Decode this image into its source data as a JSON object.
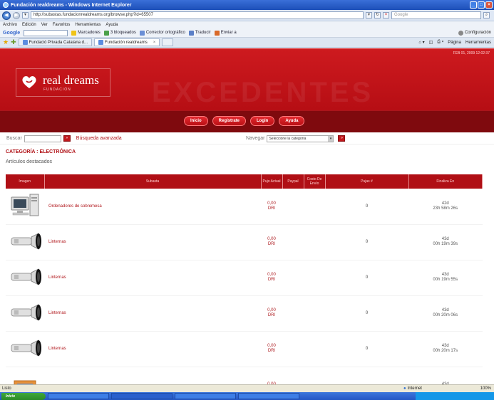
{
  "window": {
    "title": "Fundación realdreams - Windows Internet Explorer"
  },
  "address_bar": {
    "url": "http://subastas.fundacionrealdreams.org/browse.php?id=65507",
    "search_placeholder": "Google"
  },
  "menu": [
    "Archivo",
    "Edición",
    "Ver",
    "Favoritos",
    "Herramientas",
    "Ayuda"
  ],
  "google_toolbar": {
    "logo": "Google",
    "items": [
      "Marcadores",
      "3 bloqueados",
      "Corrector ortográfico",
      "Traducir",
      "Enviar a"
    ],
    "config": "Configuración"
  },
  "tabs": [
    {
      "label": "Fundació Privada Catalana d..."
    },
    {
      "label": "Fundación realdreams"
    }
  ],
  "tab_tools": [
    "Página",
    "Herramientas"
  ],
  "site": {
    "logo_title": "real dreams",
    "logo_subtitle": "FUNDACIÓN",
    "banner_watermark": "EXCEDENTES",
    "date": "FEB 01, 2009 12:02:37",
    "nav": [
      "Inicio",
      "Regístrate",
      "Login",
      "Ayuda"
    ],
    "search_label": "Buscar",
    "search_go": "»",
    "advanced_search": "Búsqueda avanzada",
    "browse_label": "Navegar",
    "browse_select": "Seleccione la categoría",
    "category_title": "CATEGORÍA : ELECTRÓNICA",
    "featured_label": "Artículos destacados"
  },
  "table": {
    "headers": [
      "Imagen",
      "Subasta",
      "Pujo Actual",
      "Paypal",
      "Costo De Envío",
      "Pujas #",
      "Finaliza En"
    ],
    "rows": [
      {
        "image": "desktop-computer",
        "name": "Ordenadores de sobremesa",
        "price": "0,00",
        "currency": "DRI",
        "bids": "0",
        "days": "42d",
        "time": "23h 58m 26s"
      },
      {
        "image": "flashlight",
        "name": "Linternas",
        "price": "0,00",
        "currency": "DRI",
        "bids": "0",
        "days": "43d",
        "time": "00h 19m 39s"
      },
      {
        "image": "flashlight",
        "name": "Linternas",
        "price": "0,00",
        "currency": "DRI",
        "bids": "0",
        "days": "43d",
        "time": "00h 19m 55s"
      },
      {
        "image": "flashlight",
        "name": "Linternas",
        "price": "0,00",
        "currency": "DRI",
        "bids": "0",
        "days": "43d",
        "time": "00h 20m 06s"
      },
      {
        "image": "flashlight",
        "name": "Linternas",
        "price": "0,00",
        "currency": "DRI",
        "bids": "0",
        "days": "43d",
        "time": "00h 20m 17s"
      },
      {
        "image": "box",
        "name": "",
        "price": "0,00",
        "currency": "",
        "bids": "",
        "days": "43d",
        "time": ""
      }
    ]
  },
  "status_bar": {
    "text": "Listo",
    "zone": "Internet",
    "zoom": "100%"
  },
  "taskbar": {
    "start": "Inicio",
    "tasks": [
      "",
      "",
      "",
      "",
      ""
    ]
  },
  "colors": {
    "brand_red": "#c0171c",
    "nav_dark": "#7f0a0e"
  }
}
